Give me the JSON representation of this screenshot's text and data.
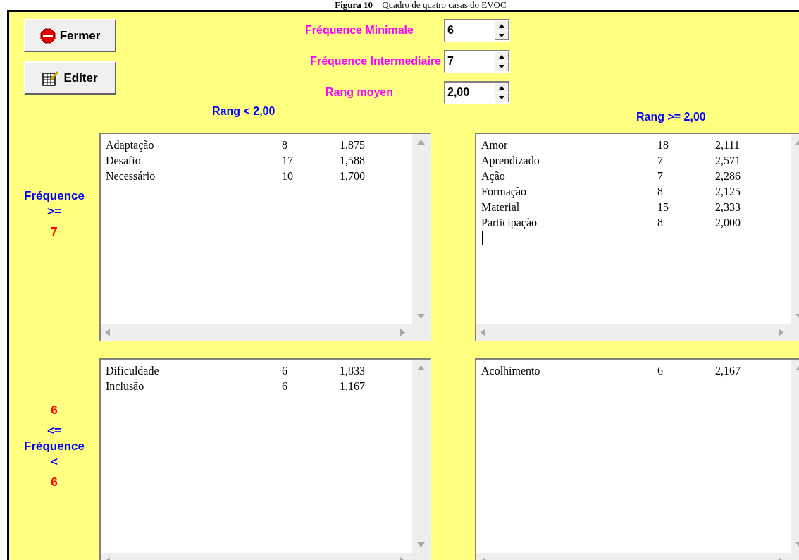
{
  "caption": "**Figura 10** – Quadro de quatro casas do EVOC",
  "buttons": [
    {
      "label": "Fermer",
      "kind": "stop"
    },
    {
      "label": "Editer",
      "kind": "edit"
    }
  ],
  "parameters": [
    {
      "label": "Fréquence Minimale",
      "value": "6"
    },
    {
      "label": "Fréquence Intermediaire",
      "value": "7"
    },
    {
      "label": "Rang moyen",
      "value": "2,00"
    }
  ],
  "column_headings": [
    "Rang < 2,00",
    "Rang >= 2,00"
  ],
  "row_headings": [
    {
      "lines": [
        {
          "text": "Fréquence",
          "kind": "label"
        },
        {
          "text": ">=",
          "kind": "label"
        },
        {
          "text": "7",
          "kind": "value"
        }
      ]
    },
    {
      "lines": [
        {
          "text": "6",
          "kind": "value"
        },
        {
          "text": "<=",
          "kind": "label"
        },
        {
          "text": "Fréquence",
          "kind": "label"
        },
        {
          "text": "<",
          "kind": "label"
        },
        {
          "text": "6",
          "kind": "value"
        }
      ]
    }
  ],
  "quadrants": [
    {
      "focused": false,
      "rows": [
        {
          "word": "Adaptação",
          "frequency": "8",
          "rank": "1,875"
        },
        {
          "word": "Desafio",
          "frequency": "17",
          "rank": "1,588"
        },
        {
          "word": "Necessário",
          "frequency": "10",
          "rank": "1,700"
        }
      ]
    },
    {
      "focused": true,
      "rows": [
        {
          "word": "Amor",
          "frequency": "18",
          "rank": "2,111"
        },
        {
          "word": "Aprendizado",
          "frequency": "7",
          "rank": "2,571"
        },
        {
          "word": "Ação",
          "frequency": "7",
          "rank": "2,286"
        },
        {
          "word": "Formação",
          "frequency": "8",
          "rank": "2,125"
        },
        {
          "word": "Material",
          "frequency": "15",
          "rank": "2,333"
        },
        {
          "word": "Participação",
          "frequency": "8",
          "rank": "2,000"
        }
      ]
    },
    {
      "focused": false,
      "rows": [
        {
          "word": "Dificuldade",
          "frequency": "6",
          "rank": "1,833"
        },
        {
          "word": "Inclusão",
          "frequency": "6",
          "rank": "1,167"
        }
      ]
    },
    {
      "focused": false,
      "rows": [
        {
          "word": "Acolhimento",
          "frequency": "6",
          "rank": "2,167"
        }
      ]
    }
  ]
}
